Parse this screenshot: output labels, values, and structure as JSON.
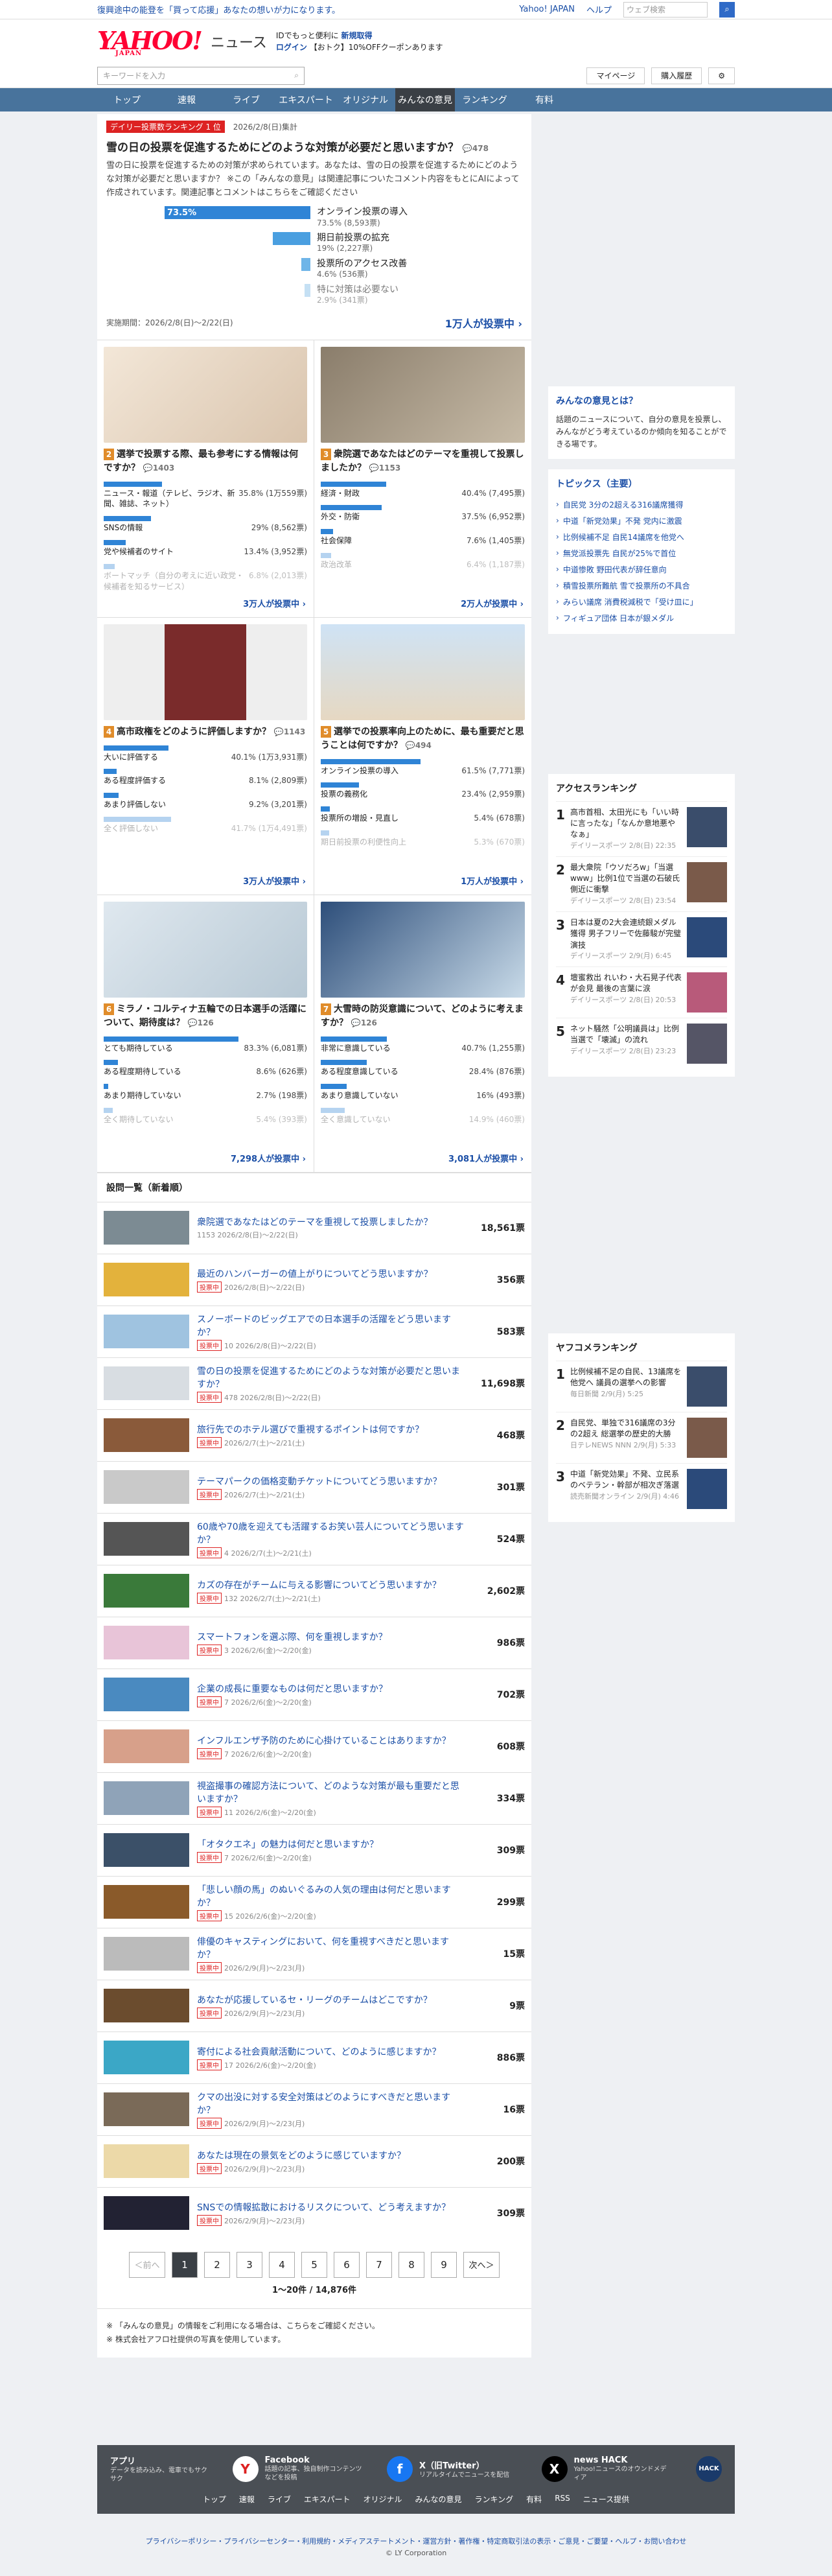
{
  "topbar": {
    "notice": "復興途中の能登を「買って応援」あなたの想いが力になります。",
    "links": [
      "Yahoo! JAPAN",
      "ヘルプ"
    ],
    "search_placeholder": "ウェブ検索",
    "search_button": "ログイン"
  },
  "header": {
    "brand": "YAHOO!",
    "brand_sub": "JAPAN",
    "service": "ニュース",
    "login_note": "IDでもっと便利に",
    "new_reg": "新規取得",
    "login": "ログイン",
    "coupon": "【おトク】10%OFFクーポンあります"
  },
  "searchrow": {
    "placeholder": "キーワードを入力",
    "mypage": "マイページ",
    "history": "購入履歴"
  },
  "nav": [
    "トップ",
    "速報",
    "ライブ",
    "エキスパート",
    "オリジナル",
    "みんなの意見",
    "ランキング",
    "有料"
  ],
  "hero": {
    "badge": "デイリー投票数ランキング 1 位",
    "date": "2026/2/8(日)集計",
    "title": "雪の日の投票を促進するためにどのような対策が必要だと思いますか？",
    "comments": "478",
    "desc": "雪の日に投票を促進するための対策が求められています。あなたは、雪の日の投票を促進するためにどのような対策が必要だと思いますか？ ※この「みんなの意見」は関連記事についたコメント内容をもとにAIによって作成されています。関連記事とコメントはこちらをご確認ください",
    "top_pct": "73.5%",
    "options": [
      {
        "label": "オンライン投票の導入",
        "sub": "73.5% (8,593票)",
        "w": 160
      },
      {
        "label": "期日前投票の拡充",
        "sub": "19% (2,227票)",
        "w": 41
      },
      {
        "label": "投票所のアクセス改善",
        "sub": "4.6% (536票)",
        "w": 10
      },
      {
        "label": "特に対策は必要ない",
        "sub": "2.9% (341票)",
        "w": 6
      }
    ],
    "period": "実施期間：2026/2/8(日)〜2/22(日)",
    "votes": "1万人が投票中"
  },
  "cards": [
    {
      "num": "2",
      "title": "選挙で投票する際、最も参考にする情報は何ですか？",
      "meta": "1403",
      "options": [
        {
          "l": "ニュース・報道（テレビ、ラジオ、新聞、雑誌、ネット）",
          "v": "35.8% (1万559票)",
          "w": 35.8
        },
        {
          "l": "SNSの情報",
          "v": "29% (8,562票)",
          "w": 29
        },
        {
          "l": "党や候補者のサイト",
          "v": "13.4% (3,952票)",
          "w": 13.4
        },
        {
          "l": "ボートマッチ（自分の考えに近い政党・候補者を知るサービス）",
          "v": "6.8% (2,013票)",
          "w": 6.8
        }
      ],
      "votes": "3万人が投票中",
      "img": "bg1"
    },
    {
      "num": "3",
      "title": "衆院選であなたはどのテーマを重視して投票しましたか？",
      "meta": "1153",
      "options": [
        {
          "l": "経済・財政",
          "v": "40.4% (7,495票)",
          "w": 40.4
        },
        {
          "l": "外交・防衛",
          "v": "37.5% (6,952票)",
          "w": 37.5
        },
        {
          "l": "社会保障",
          "v": "7.6% (1,405票)",
          "w": 7.6
        },
        {
          "l": "政治改革",
          "v": "6.4% (1,187票)",
          "w": 6.4
        }
      ],
      "votes": "2万人が投票中",
      "img": "bg2"
    },
    {
      "num": "4",
      "title": "高市政権をどのように評価しますか？",
      "meta": "1143",
      "options": [
        {
          "l": "大いに評価する",
          "v": "40.1% (1万3,931票)",
          "w": 40.1
        },
        {
          "l": "ある程度評価する",
          "v": "8.1% (2,809票)",
          "w": 8.1
        },
        {
          "l": "あまり評価しない",
          "v": "9.2% (3,201票)",
          "w": 9.2
        },
        {
          "l": "全く評価しない",
          "v": "41.7% (1万4,491票)",
          "w": 41.7
        }
      ],
      "votes": "3万人が投票中",
      "img": "bg3"
    },
    {
      "num": "5",
      "title": "選挙での投票率向上のために、最も重要だと思うことは何ですか？",
      "meta": "494",
      "options": [
        {
          "l": "オンライン投票の導入",
          "v": "61.5% (7,771票)",
          "w": 61.5
        },
        {
          "l": "投票の義務化",
          "v": "23.4% (2,959票)",
          "w": 23.4
        },
        {
          "l": "投票所の増設・見直し",
          "v": "5.4% (678票)",
          "w": 5.4
        },
        {
          "l": "期日前投票の利便性向上",
          "v": "5.3% (670票)",
          "w": 5.3
        }
      ],
      "votes": "1万人が投票中",
      "img": "bg4"
    },
    {
      "num": "6",
      "title": "ミラノ・コルティナ五輪での日本選手の活躍について、期待度は？",
      "meta": "126",
      "options": [
        {
          "l": "とても期待している",
          "v": "83.3% (6,081票)",
          "w": 83.3
        },
        {
          "l": "ある程度期待している",
          "v": "8.6% (626票)",
          "w": 8.6
        },
        {
          "l": "あまり期待していない",
          "v": "2.7% (198票)",
          "w": 2.7
        },
        {
          "l": "全く期待していない",
          "v": "5.4% (393票)",
          "w": 5.4
        }
      ],
      "votes": "7,298人が投票中",
      "img": "bg5"
    },
    {
      "num": "7",
      "title": "大雪時の防災意識について、どのように考えますか？",
      "meta": "126",
      "options": [
        {
          "l": "非常に意識している",
          "v": "40.7% (1,255票)",
          "w": 40.7
        },
        {
          "l": "ある程度意識している",
          "v": "28.4% (876票)",
          "w": 28.4
        },
        {
          "l": "あまり意識していない",
          "v": "16% (493票)",
          "w": 16
        },
        {
          "l": "全く意識していない",
          "v": "14.9% (460票)",
          "w": 14.9
        }
      ],
      "votes": "3,081人が投票中",
      "img": "bg6"
    }
  ],
  "list_title": "設問一覧（新着順）",
  "list": [
    {
      "t": "衆院選であなたはどのテーマを重視して投票しましたか？",
      "m": "1153  2026/2/8(日)〜2/22(日)",
      "v": "18,561票",
      "ong": false
    },
    {
      "t": "最近のハンバーガーの値上がりについてどう思いますか？",
      "m": "2026/2/8(日)〜2/22(日)",
      "v": "356票",
      "ong": true
    },
    {
      "t": "スノーボードのビッグエアでの日本選手の活躍をどう思いますか？",
      "m": "10  2026/2/8(日)〜2/22(日)",
      "v": "583票",
      "ong": true
    },
    {
      "t": "雪の日の投票を促進するためにどのような対策が必要だと思いますか？",
      "m": "478  2026/2/8(日)〜2/22(日)",
      "v": "11,698票",
      "ong": true
    },
    {
      "t": "旅行先でのホテル選びで重視するポイントは何ですか？",
      "m": "2026/2/7(土)〜2/21(土)",
      "v": "468票",
      "ong": true
    },
    {
      "t": "テーマパークの価格変動チケットについてどう思いますか？",
      "m": "2026/2/7(土)〜2/21(土)",
      "v": "301票",
      "ong": true
    },
    {
      "t": "60歳や70歳を迎えても活躍するお笑い芸人についてどう思いますか？",
      "m": "4  2026/2/7(土)〜2/21(土)",
      "v": "524票",
      "ong": true
    },
    {
      "t": "カズの存在がチームに与える影響についてどう思いますか？",
      "m": "132  2026/2/7(土)〜2/21(土)",
      "v": "2,602票",
      "ong": true
    },
    {
      "t": "スマートフォンを選ぶ際、何を重視しますか？",
      "m": "3  2026/2/6(金)〜2/20(金)",
      "v": "986票",
      "ong": true
    },
    {
      "t": "企業の成長に重要なものは何だと思いますか？",
      "m": "7  2026/2/6(金)〜2/20(金)",
      "v": "702票",
      "ong": true
    },
    {
      "t": "インフルエンザ予防のために心掛けていることはありますか？",
      "m": "7  2026/2/6(金)〜2/20(金)",
      "v": "608票",
      "ong": true
    },
    {
      "t": "視盗撮事の確認方法について、どのような対策が最も重要だと思いますか？",
      "m": "11  2026/2/6(金)〜2/20(金)",
      "v": "334票",
      "ong": true
    },
    {
      "t": "「オタクエネ」の魅力は何だと思いますか？",
      "m": "7  2026/2/6(金)〜2/20(金)",
      "v": "309票",
      "ong": true
    },
    {
      "t": "「悲しい顔の馬」のぬいぐるみの人気の理由は何だと思いますか？",
      "m": "15  2026/2/6(金)〜2/20(金)",
      "v": "299票",
      "ong": true
    },
    {
      "t": "俳優のキャスティングにおいて、何を重視すべきだと思いますか？",
      "m": "2026/2/9(月)〜2/23(月)",
      "v": "15票",
      "ong": true
    },
    {
      "t": "あなたが応援しているセ・リーグのチームはどこですか？",
      "m": "2026/2/9(月)〜2/23(月)",
      "v": "9票",
      "ong": true
    },
    {
      "t": "寄付による社会貢献活動について、どのように感じますか？",
      "m": "17  2026/2/6(金)〜2/20(金)",
      "v": "886票",
      "ong": true
    },
    {
      "t": "クマの出没に対する安全対策はどのようにすべきだと思いますか？",
      "m": "2026/2/9(月)〜2/23(月)",
      "v": "16票",
      "ong": true
    },
    {
      "t": "あなたは現在の景気をどのように感じていますか？",
      "m": "2026/2/9(月)〜2/23(月)",
      "v": "200票",
      "ong": true
    },
    {
      "t": "SNSでの情報拡散におけるリスクについて、どう考えますか？",
      "m": "2026/2/9(月)〜2/23(月)",
      "v": "309票",
      "ong": true
    }
  ],
  "ongoing_label": "投票中",
  "pager": {
    "prev": "＜前へ",
    "pages": [
      "1",
      "2",
      "3",
      "4",
      "5",
      "6",
      "7",
      "8",
      "9"
    ],
    "next": "次へ＞",
    "count": "1〜20件 / 14,876件"
  },
  "notes": [
    "「みんなの意見」の情報をご利用になる場合は、こちらをご確認ください。",
    "株式会社アフロ社提供の写真を使用しています。"
  ],
  "side": {
    "about_title": "みんなの意見とは？",
    "about_text": "話題のニュースについて、自分の意見を投票し、みんながどう考えているのか傾向を知ることができる場です。",
    "topics_title": "トピックス（主要）",
    "topics": [
      "自民党 3分の2超える316議席獲得",
      "中道「新党効果」不発 党内に激震",
      "比例候補不足 自民14議席を他党へ",
      "無党派投票先 自民が25%で首位",
      "中道惨敗 野田代表が辞任意向",
      "積雪投票所難航 雪で投票所の不具合",
      "みらい議席 消費税減税で「受け皿に」",
      "フィギュア団体 日本が銀メダル"
    ],
    "access_title": "アクセスランキング",
    "access": [
      {
        "t": "高市首相、太田光にも「いい時に言ったな」「なんか意地悪やなぁ」",
        "s": "デイリースポーツ 2/8(日) 22:35"
      },
      {
        "t": "最大衆院「ウソだろw」「当選www」比例1位で当選の石破氏側近に衝撃",
        "s": "デイリースポーツ 2/8(日) 23:54"
      },
      {
        "t": "日本は夏の2大会連続銀メダル獲得 男子フリーで佐藤駿が完璧演技",
        "s": "デイリースポーツ 2/9(月) 6:45"
      },
      {
        "t": "壇蜜救出 れいわ・大石晃子代表が会見 最後の言葉に涙",
        "s": "デイリースポーツ 2/8(日) 20:53"
      },
      {
        "t": "ネット騒然「公明議員は」比例当選で「壊滅」の流れ",
        "s": "デイリースポーツ 2/8(日) 23:23"
      }
    ],
    "yahoo_title": "ヤフコメランキング",
    "yahoo": [
      {
        "t": "比例候補不足の自民、13議席を他党へ 議員の選挙への影響",
        "s": "毎日新聞 2/9(月) 5:25"
      },
      {
        "t": "自民党、単独で316議席の3分の2超え 総選挙の歴史的大勝",
        "s": "日テレNEWS NNN 2/9(月) 5:33"
      },
      {
        "t": "中道「新党効果」不発、立民系のベテラン・幹部が相次ぎ落選",
        "s": "読売新聞オンライン 2/9(月) 4:46"
      }
    ]
  },
  "footer": {
    "cols": [
      {
        "t": "アプリ",
        "d": "データを読み込み、電車でもサクサク"
      },
      {
        "t": "Facebook",
        "d": "話題の記事、独自制作コンテンツなどを投稿"
      },
      {
        "t": "X（旧Twitter）",
        "d": "リアルタイムでニュースを配信"
      },
      {
        "t": "news HACK",
        "d": "Yahoo!ニュースのオウンドメディア"
      }
    ],
    "links": [
      "トップ",
      "速報",
      "ライブ",
      "エキスパート",
      "オリジナル",
      "みんなの意見",
      "ランキング",
      "有料",
      "RSS",
      "ニュース提供"
    ],
    "bottom": "プライバシーポリシー・プライバシーセンター・利用規約・メディアステートメント・運営方針・著作権・特定商取引法の表示・ご意見・ご要望・ヘルプ・お問い合わせ",
    "copy": "© LY Corporation"
  },
  "colors": {
    "accent": "#2f84d6",
    "nav": "#48739c",
    "red": "#d22"
  }
}
